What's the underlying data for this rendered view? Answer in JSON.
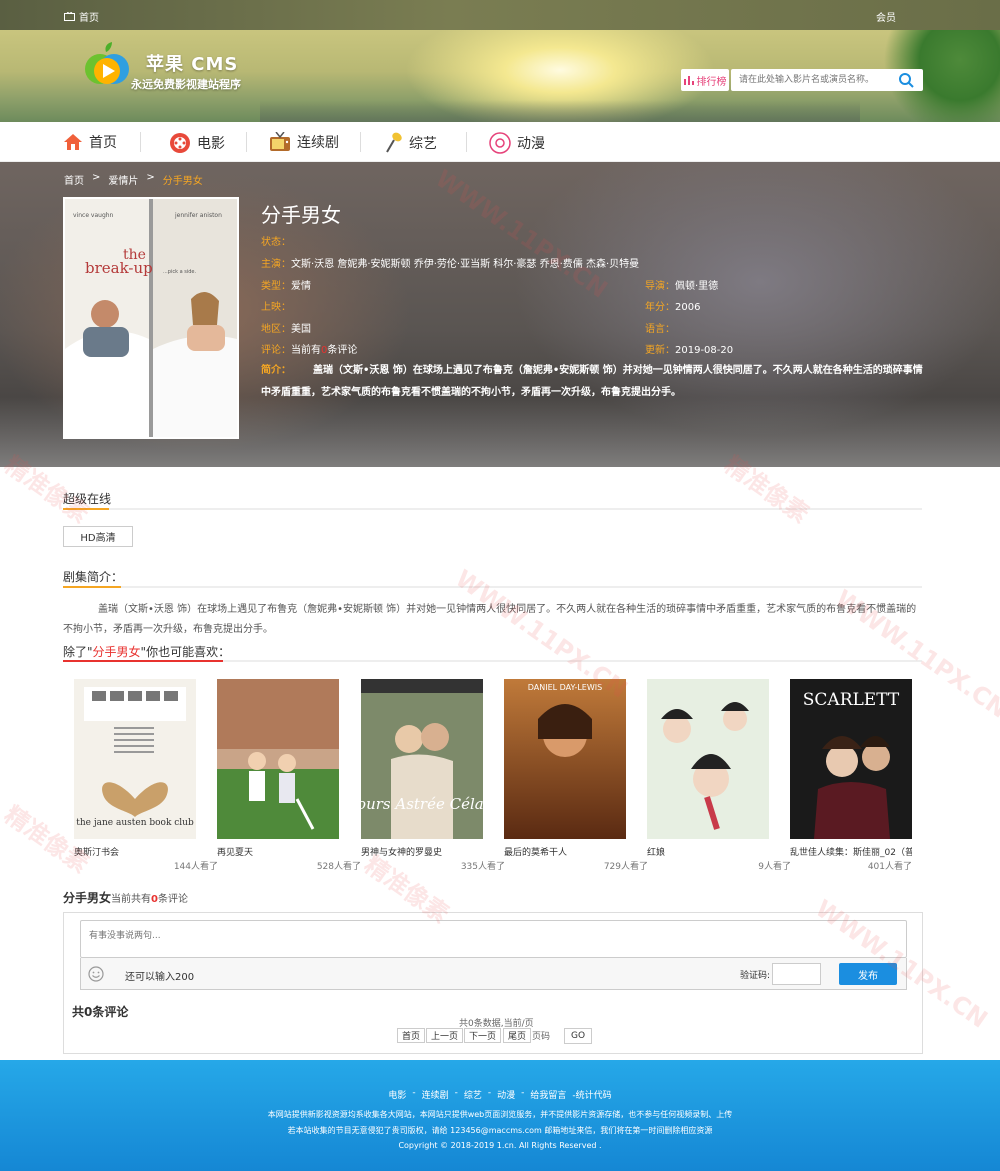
{
  "topbar": {
    "home_label": "首页",
    "member_label": "会员"
  },
  "header": {
    "brand": "苹果 CMS",
    "slogan": "永远免费影视建站程序",
    "rank_label": "排行榜",
    "search_placeholder": "请在此处输入影片名或演员名称。"
  },
  "nav": {
    "items": [
      {
        "label": "首页",
        "icon": "house-icon"
      },
      {
        "label": "电影",
        "icon": "film-reel-icon"
      },
      {
        "label": "连续剧",
        "icon": "tv-icon"
      },
      {
        "label": "综艺",
        "icon": "microphone-icon"
      },
      {
        "label": "动漫",
        "icon": "anime-icon"
      }
    ]
  },
  "breadcrumb": {
    "home": "首页",
    "sep1": ">",
    "category": "爱情片",
    "sep2": ">",
    "current": "分手男女"
  },
  "movie": {
    "poster": {
      "actor_left": "vince vaughn",
      "actor_right": "jennifer aniston",
      "title_top": "the",
      "title_main": "break-up",
      "tagline": "...pick a side."
    },
    "title": "分手男女",
    "status_k": "状态：",
    "status_v": "",
    "cast_k": "主演：",
    "cast_v": "文斯·沃恩 詹妮弗·安妮斯顿 乔伊·劳伦·亚当斯 科尔·豪瑟 乔恩·费儒 杰森·贝特曼",
    "genre_k": "类型：",
    "genre_v": "爱情",
    "director_k": "导演：",
    "director_v": "佩顿·里德",
    "release_k": "上映：",
    "release_v": "",
    "year_k": "年分：",
    "year_v": "2006",
    "region_k": "地区：",
    "region_v": "美国",
    "lang_k": "语言：",
    "lang_v": "",
    "review_k": "评论：",
    "review_pre": "当前有",
    "review_n": "0",
    "review_post": "条评论",
    "update_k": "更新：",
    "update_v": "2019-08-20",
    "intro_k": "简介：",
    "intro_v": "盖瑞（文斯•沃恩 饰）在球场上遇见了布鲁克（詹妮弗•安妮斯顿 饰）并对她一见钟情两人很快同居了。不久两人就在各种生活的琐碎事情中矛盾重重，艺术家气质的布鲁克看不惯盖瑞的不拘小节，矛盾再一次升级，布鲁克提出分手。"
  },
  "sources": {
    "title": "超级在线",
    "button": "HD高清"
  },
  "plot": {
    "title": "剧集简介：",
    "text": "盖瑞（文斯•沃恩 饰）在球场上遇见了布鲁克（詹妮弗•安妮斯顿 饰）并对她一见钟情两人很快同居了。不久两人就在各种生活的琐碎事情中矛盾重重，艺术家气质的布鲁克看不惯盖瑞的不拘小节，矛盾再一次升级，布鲁克提出分手。"
  },
  "related": {
    "pre": "除了\"",
    "name": "分手男女",
    "post": "\"你也可能喜欢：",
    "items": [
      {
        "name": "奥斯汀书会",
        "views": "144人看了",
        "poster_text": "the jane austen book club"
      },
      {
        "name": "再见夏天",
        "views": "528人看了",
        "poster_text": ""
      },
      {
        "name": "男神与女神的罗曼史",
        "views": "335人看了",
        "poster_text": "Amours Astrée Céladon"
      },
      {
        "name": "最后的莫希干人",
        "views": "729人看了",
        "poster_text": "DANIEL DAY-LEWIS"
      },
      {
        "name": "红娘",
        "views": "9人看了",
        "poster_text": ""
      },
      {
        "name": "乱世佳人续集：斯佳丽_02（普",
        "views": "401人看了",
        "poster_text": "SCARLETT"
      }
    ]
  },
  "comments": {
    "title": "分手男女",
    "count_pre": "当前共有",
    "count_n": "0",
    "count_post": "条评论",
    "placeholder": "有事没事说两句...",
    "remain": "还可以输入200",
    "verify_label": "验证码:",
    "submit": "发布",
    "total": "共0条评论",
    "page_info": "共0条数据,当前/页",
    "pager": {
      "first": "首页",
      "prev": "上一页",
      "next": "下一页",
      "last": "尾页",
      "page_label": "页码",
      "go": "GO"
    }
  },
  "footer": {
    "links": [
      "电影",
      "-",
      "连续剧",
      "-",
      "综艺",
      "-",
      "动漫",
      "-",
      "给我留言",
      "-统计代码"
    ],
    "line1": "本网站提供新影视资源均系收集各大网站，本网站只提供web页面浏览服务，并不提供影片资源存储，也不参与任何视频录制、上传",
    "line2": "若本站收集的节目无意侵犯了贵司版权，请给 123456@maccms.com 邮箱地址来信，我们将在第一时间删除相应资源",
    "line3": "Copyright © 2018-2019 1.cn. All Rights Reserved ."
  },
  "watermark": [
    "精准像素",
    "WWW.11PX.CN"
  ],
  "colors": {
    "accent": "#f5a623",
    "brand_blue": "#1b8ee0",
    "highlight_red": "#e8322f"
  }
}
